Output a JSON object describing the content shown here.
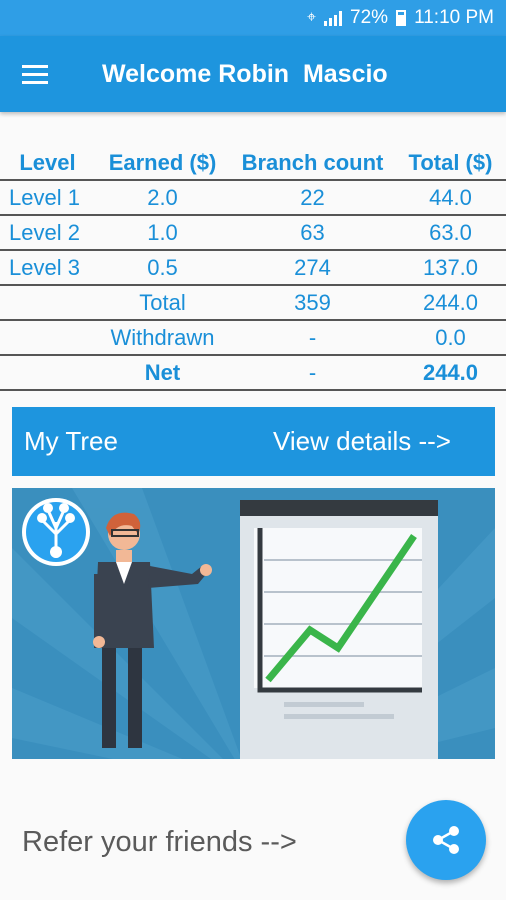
{
  "status_bar": {
    "battery": "72%",
    "time": "11:10 PM"
  },
  "app_bar": {
    "title": "Welcome Robin  Mascio"
  },
  "table": {
    "headers": [
      "Level",
      "Earned ($)",
      "Branch count",
      "Total ($)"
    ],
    "rows": [
      [
        "Level 1",
        "2.0",
        "22",
        "44.0"
      ],
      [
        "Level 2",
        "1.0",
        "63",
        "63.0"
      ],
      [
        "Level 3",
        "0.5",
        "274",
        "137.0"
      ]
    ],
    "total": {
      "label": "Total",
      "branch": "359",
      "amount": "244.0"
    },
    "withdrawn": {
      "label": "Withdrawn",
      "branch": "-",
      "amount": "0.0"
    },
    "net": {
      "label": "Net",
      "branch": "-",
      "amount": "244.0"
    }
  },
  "tree": {
    "title": "My Tree",
    "link": "View details -->"
  },
  "refer": {
    "label": "Refer your friends -->"
  },
  "colors": {
    "primary": "#1e95de",
    "text_blue": "#1a8fd8",
    "fab": "#2aa2ef"
  }
}
